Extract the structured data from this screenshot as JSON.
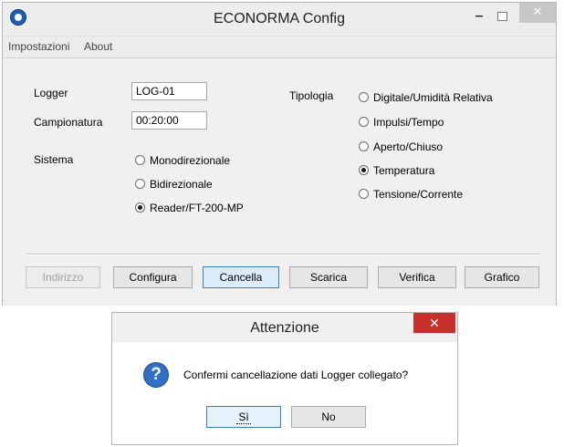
{
  "window": {
    "title": "ECONORMA Config",
    "controls": {
      "minimize": "–",
      "close": "✕"
    }
  },
  "menu": {
    "items": [
      "Impostazioni",
      "About"
    ]
  },
  "form": {
    "logger_label": "Logger",
    "logger_value": "LOG-01",
    "campionatura_label": "Campionatura",
    "campionatura_value": "00:20:00",
    "sistema_label": "Sistema",
    "sistema_options": [
      "Monodirezionale",
      "Bidirezionale",
      "Reader/FT-200-MP"
    ],
    "sistema_selected": "Reader/FT-200-MP",
    "tipologia_label": "Tipologia",
    "tipologia_options": [
      "Digitale/Umidità Relativa",
      "Impulsi/Tempo",
      "Aperto/Chiuso",
      "Temperatura",
      "Tensione/Corrente"
    ],
    "tipologia_selected": "Temperatura"
  },
  "buttons": {
    "indirizzo": "Indirizzo",
    "configura": "Configura",
    "cancella": "Cancella",
    "scarica": "Scarica",
    "verifica": "Verifica",
    "grafico": "Grafico"
  },
  "dialog": {
    "title": "Attenzione",
    "close": "✕",
    "icon": "question-icon",
    "message": "Confermi cancellazione dati Logger collegato?",
    "yes": "Sì",
    "no": "No"
  },
  "colors": {
    "dialog_close": "#c9302c",
    "focus_border": "#3c7fb1",
    "info_icon": "#2f6fc4"
  }
}
